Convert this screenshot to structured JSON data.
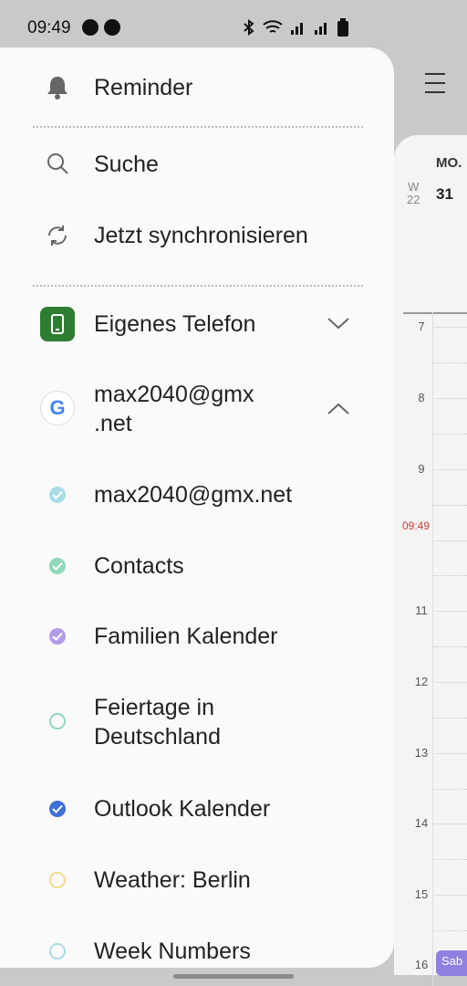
{
  "status_bar": {
    "time": "09:49"
  },
  "calendar": {
    "day_header": "MO.",
    "week_letter": "W",
    "week_number": "22",
    "day_number": "31",
    "hours": [
      "7",
      "8",
      "9",
      "11",
      "12",
      "13",
      "14",
      "15",
      "16"
    ],
    "current_time": "09:49",
    "event_label": "Sab"
  },
  "drawer": {
    "reminder": "Reminder",
    "search": "Suche",
    "sync": "Jetzt synchronisieren",
    "own_phone": "Eigenes Telefon",
    "google_account_line1": "max2040@gmx",
    "google_account_line2": ".net",
    "calendars": [
      {
        "label": "max2040@gmx.net",
        "color": "#a9dce7",
        "checked": true
      },
      {
        "label": "Contacts",
        "color": "#8fd8b8",
        "checked": true
      },
      {
        "label": "Familien Kalender",
        "color": "#b39ae8",
        "checked": true
      },
      {
        "label": "Feiertage in",
        "label2": "Deutschland",
        "color": "#8fd8b8",
        "checked": false
      },
      {
        "label": "Outlook Kalender",
        "color": "#3d6fd6",
        "checked": true
      },
      {
        "label": "Weather: Berlin",
        "color": "#f0dc8c",
        "checked": false
      },
      {
        "label": "Week Numbers",
        "color": "#a9dce7",
        "checked": false
      }
    ]
  }
}
